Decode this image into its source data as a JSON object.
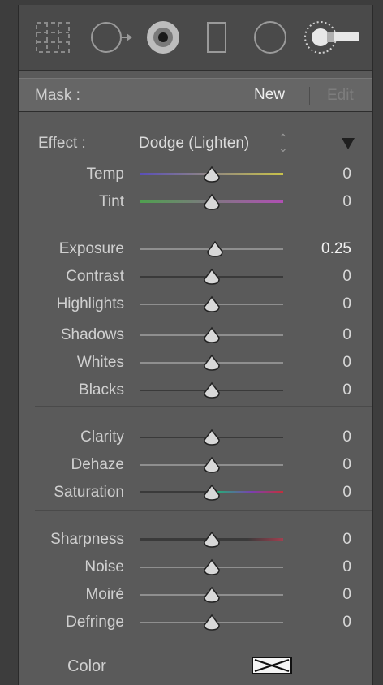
{
  "mask": {
    "label": "Mask :",
    "new_label": "New",
    "edit_label": "Edit"
  },
  "effect": {
    "label": "Effect :",
    "value": "Dodge (Lighten)",
    "stepper_glyph": "⌃⌄"
  },
  "temp_tint": [
    {
      "name": "Temp",
      "value": "0",
      "level": 0.5,
      "track": "temp"
    },
    {
      "name": "Tint",
      "value": "0",
      "level": 0.5,
      "track": "tint"
    }
  ],
  "tone": [
    {
      "name": "Exposure",
      "value": "0.25",
      "level": 0.525
    },
    {
      "name": "Contrast",
      "value": "0",
      "level": 0.5
    },
    {
      "name": "Highlights",
      "value": "0",
      "level": 0.5
    },
    {
      "name": "Shadows",
      "value": "0",
      "level": 0.5
    },
    {
      "name": "Whites",
      "value": "0",
      "level": 0.5
    },
    {
      "name": "Blacks",
      "value": "0",
      "level": 0.5
    }
  ],
  "presence": [
    {
      "name": "Clarity",
      "value": "0",
      "level": 0.5
    },
    {
      "name": "Dehaze",
      "value": "0",
      "level": 0.5
    },
    {
      "name": "Saturation",
      "value": "0",
      "level": 0.5,
      "track": "saturation"
    }
  ],
  "detail": [
    {
      "name": "Sharpness",
      "value": "0",
      "level": 0.5,
      "track": "sharpness"
    },
    {
      "name": "Noise",
      "value": "0",
      "level": 0.5
    },
    {
      "name": "Moiré",
      "value": "0",
      "level": 0.5
    },
    {
      "name": "Defringe",
      "value": "0",
      "level": 0.5
    }
  ],
  "color": {
    "label": "Color"
  },
  "colors": {
    "temp_left": "#5a4fb8",
    "temp_right": "#c9c24a",
    "tint_left": "#4fa04f",
    "tint_right": "#b04fb4",
    "sat_left": "#2aa87a",
    "sat_mid": "#7a3fb0",
    "sat_right": "#c42f3a",
    "sharp_right": "#a04050"
  },
  "tools": [
    "crop-icon",
    "spot-removal-icon",
    "red-eye-icon",
    "graduated-filter-icon",
    "radial-filter-icon",
    "adjustment-brush-icon"
  ]
}
